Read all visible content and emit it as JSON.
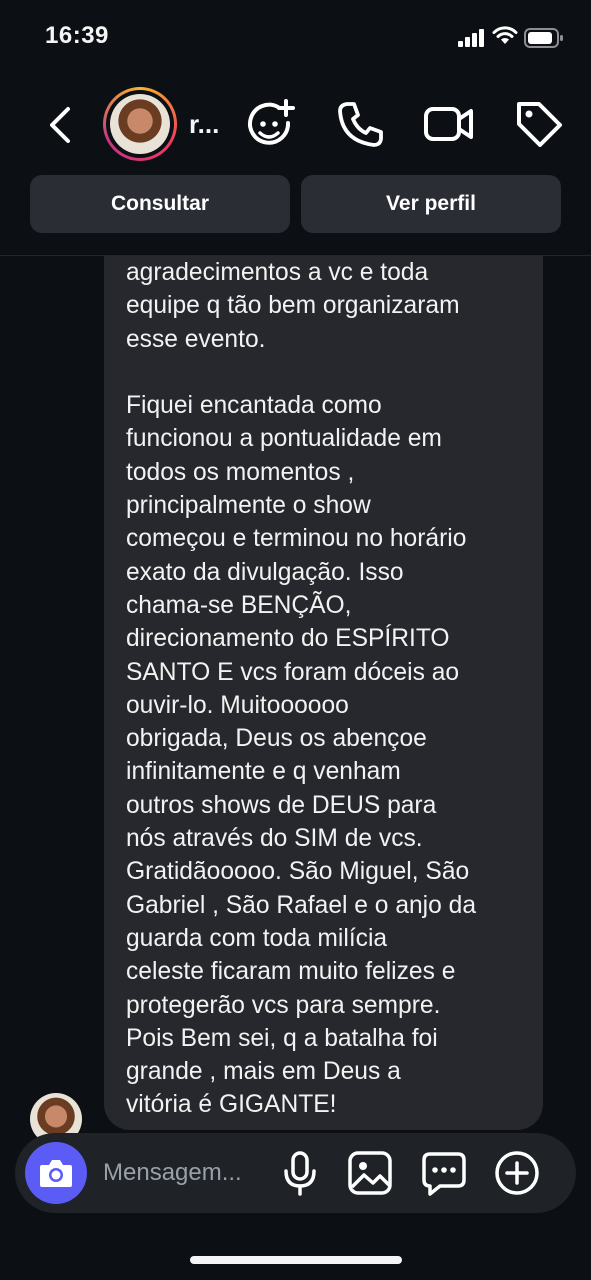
{
  "status": {
    "time": "16:39"
  },
  "header": {
    "contact_name": "r...",
    "icons": [
      "back-chevron-icon",
      "add-emoji-icon",
      "phone-icon",
      "video-camera-icon",
      "tag-icon"
    ],
    "buttons": {
      "consult": "Consultar",
      "view_profile": "Ver perfil"
    }
  },
  "message": {
    "text": "agradecimentos a vc e toda\nequipe q tão bem organizaram\nesse evento.\n\nFiquei encantada como\nfuncionou a pontualidade em\ntodos os momentos ,\nprincipalmente o show\ncomeçou e terminou no horário\nexato da divulgação.  Isso\nchama-se BENÇÃO,\ndirecionamento do ESPÍRITO\nSANTO E vcs foram dóceis ao\nouvir-lo.  Muitoooooo\nobrigada, Deus os abençoe\ninfinitamente e q venham\noutros shows de  DEUS para\nnós através do SIM de vcs.\nGratidãooooo. São Miguel, São\nGabriel , São Rafael e o anjo da\nguarda com toda milícia\nceleste ficaram muito felizes e\nprotegerão vcs para sempre.\nPois Bem sei, q a batalha foi\ngrande , mais em Deus a\nvitória é GIGANTE!"
  },
  "composer": {
    "placeholder": "Mensagem...",
    "icons": [
      "camera-icon",
      "microphone-icon",
      "gallery-icon",
      "sticker-chat-icon",
      "add-icon"
    ]
  },
  "colors": {
    "background": "#0c0f14",
    "bubble": "#26282d",
    "camera_button": "#5b5cf5"
  }
}
